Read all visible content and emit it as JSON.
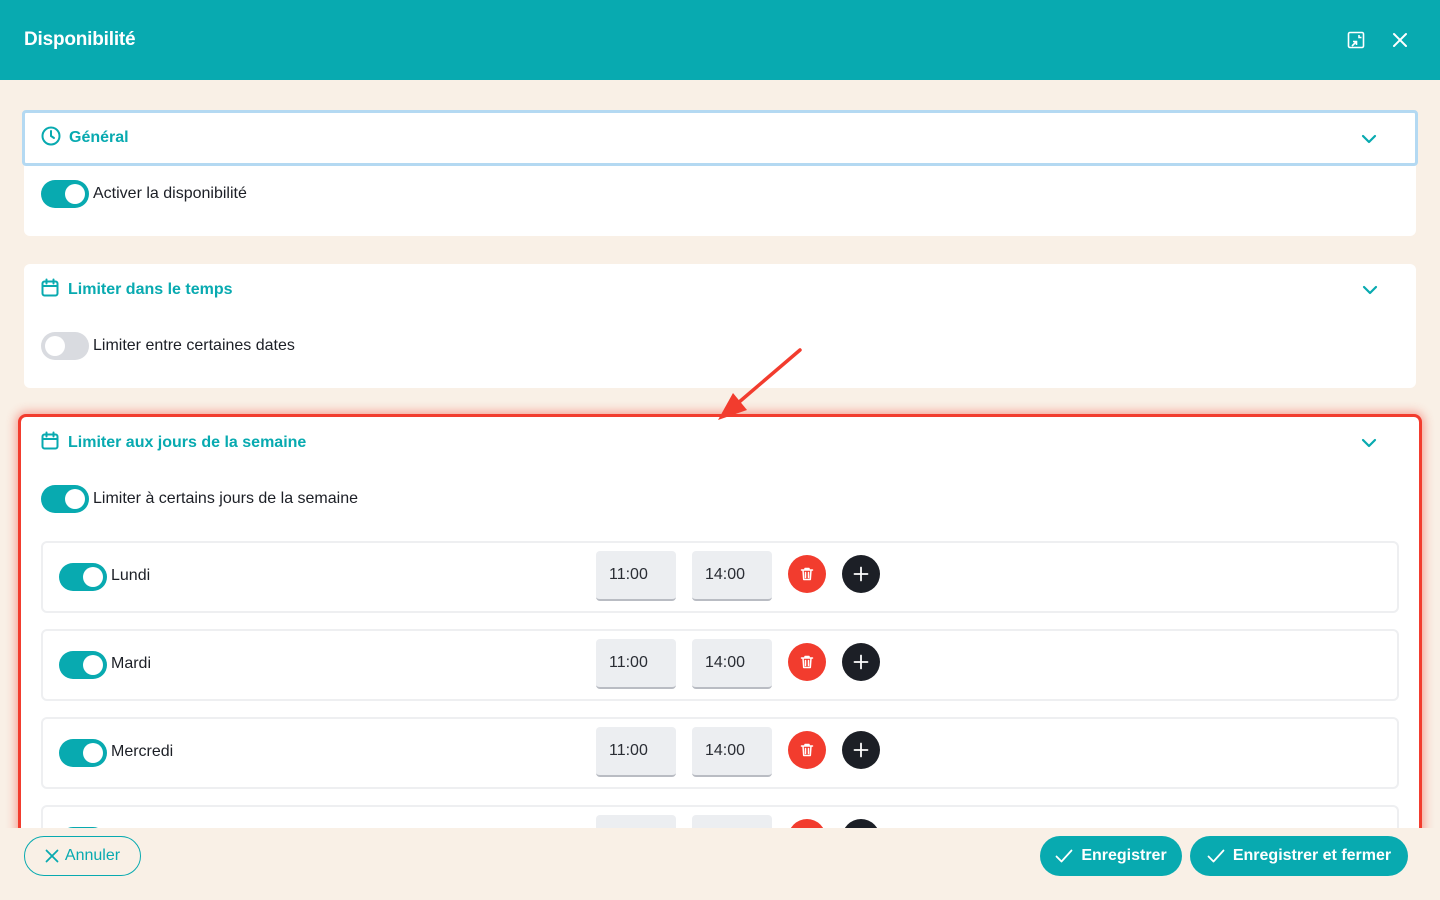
{
  "header": {
    "title": "Disponibilité"
  },
  "general": {
    "title": "Général",
    "toggle_label": "Activer la disponibilité",
    "enabled": true
  },
  "time": {
    "title": "Limiter dans le temps",
    "toggle_label": "Limiter entre certaines dates",
    "enabled": false
  },
  "week": {
    "title": "Limiter aux jours de la semaine",
    "toggle_label": "Limiter à certains jours de la semaine",
    "enabled": true,
    "days": [
      {
        "label": "Lundi",
        "start": "11:00",
        "end": "14:00",
        "enabled": true
      },
      {
        "label": "Mardi",
        "start": "11:00",
        "end": "14:00",
        "enabled": true
      },
      {
        "label": "Mercredi",
        "start": "11:00",
        "end": "14:00",
        "enabled": true
      }
    ]
  },
  "footer": {
    "cancel_label": "Annuler",
    "save_label": "Enregistrer",
    "save_close_label": "Enregistrer et fermer"
  },
  "colors": {
    "primary": "#08aab0",
    "danger": "#f23c2e",
    "dark": "#1c1f26",
    "background": "#f9f0e6",
    "highlight": "#f23c2e"
  },
  "icons": [
    "exit-fullscreen-icon",
    "close-icon",
    "clock-icon",
    "calendar-icon",
    "chevron-down-icon",
    "trash-icon",
    "plus-icon",
    "x-icon",
    "check-icon"
  ]
}
